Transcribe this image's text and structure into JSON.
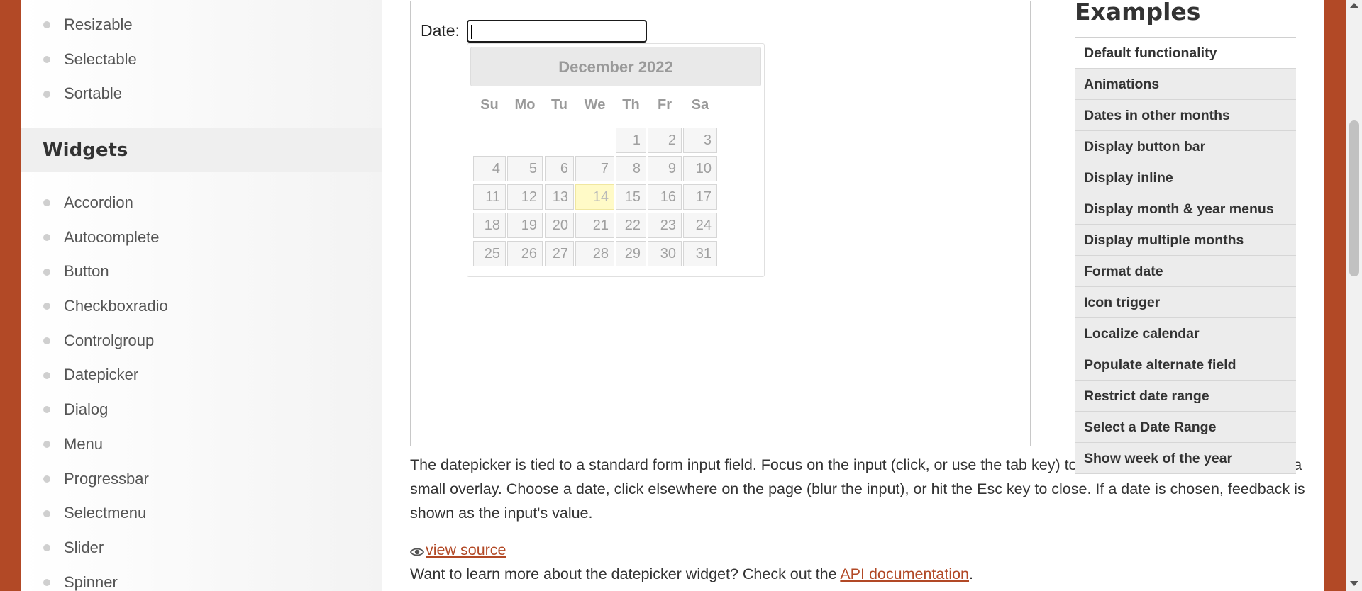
{
  "sidebar": {
    "top_items": [
      {
        "label": "Resizable"
      },
      {
        "label": "Selectable"
      },
      {
        "label": "Sortable"
      }
    ],
    "widgets_heading": "Widgets",
    "widget_items": [
      {
        "label": "Accordion"
      },
      {
        "label": "Autocomplete"
      },
      {
        "label": "Button"
      },
      {
        "label": "Checkboxradio"
      },
      {
        "label": "Controlgroup"
      },
      {
        "label": "Datepicker"
      },
      {
        "label": "Dialog"
      },
      {
        "label": "Menu"
      },
      {
        "label": "Progressbar"
      },
      {
        "label": "Selectmenu"
      },
      {
        "label": "Slider"
      },
      {
        "label": "Spinner"
      }
    ]
  },
  "demo": {
    "date_label": "Date:",
    "date_value": "",
    "datepicker": {
      "month_title": "December 2022",
      "weekdays": [
        "Su",
        "Mo",
        "Tu",
        "We",
        "Th",
        "Fr",
        "Sa"
      ],
      "weeks": [
        [
          "",
          "",
          "",
          "",
          "1",
          "2",
          "3"
        ],
        [
          "4",
          "5",
          "6",
          "7",
          "8",
          "9",
          "10"
        ],
        [
          "11",
          "12",
          "13",
          "14",
          "15",
          "16",
          "17"
        ],
        [
          "18",
          "19",
          "20",
          "21",
          "22",
          "23",
          "24"
        ],
        [
          "25",
          "26",
          "27",
          "28",
          "29",
          "30",
          "31"
        ]
      ],
      "today": "14",
      "today_color": "#fffac7"
    }
  },
  "content": {
    "description": "The datepicker is tied to a standard form input field. Focus on the input (click, or use the tab key) to open an interactive calendar in a small overlay. Choose a date, click elsewhere on the page (blur the input), or hit the Esc key to close. If a date is chosen, feedback is shown as the input's value.",
    "view_source": "view source",
    "learn_more_prefix": "Want to learn more about the datepicker widget? Check out the ",
    "api_link": "API documentation",
    "learn_more_suffix": "."
  },
  "examples": {
    "title": "Examples",
    "items": [
      {
        "label": "Default functionality"
      },
      {
        "label": "Animations"
      },
      {
        "label": "Dates in other months"
      },
      {
        "label": "Display button bar"
      },
      {
        "label": "Display inline"
      },
      {
        "label": "Display month & year menus"
      },
      {
        "label": "Display multiple months"
      },
      {
        "label": "Format date"
      },
      {
        "label": "Icon trigger"
      },
      {
        "label": "Localize calendar"
      },
      {
        "label": "Populate alternate field"
      },
      {
        "label": "Restrict date range"
      },
      {
        "label": "Select a Date Range"
      },
      {
        "label": "Show week of the year"
      }
    ]
  },
  "colors": {
    "accent": "#b24926",
    "today_highlight": "#fffac7"
  }
}
